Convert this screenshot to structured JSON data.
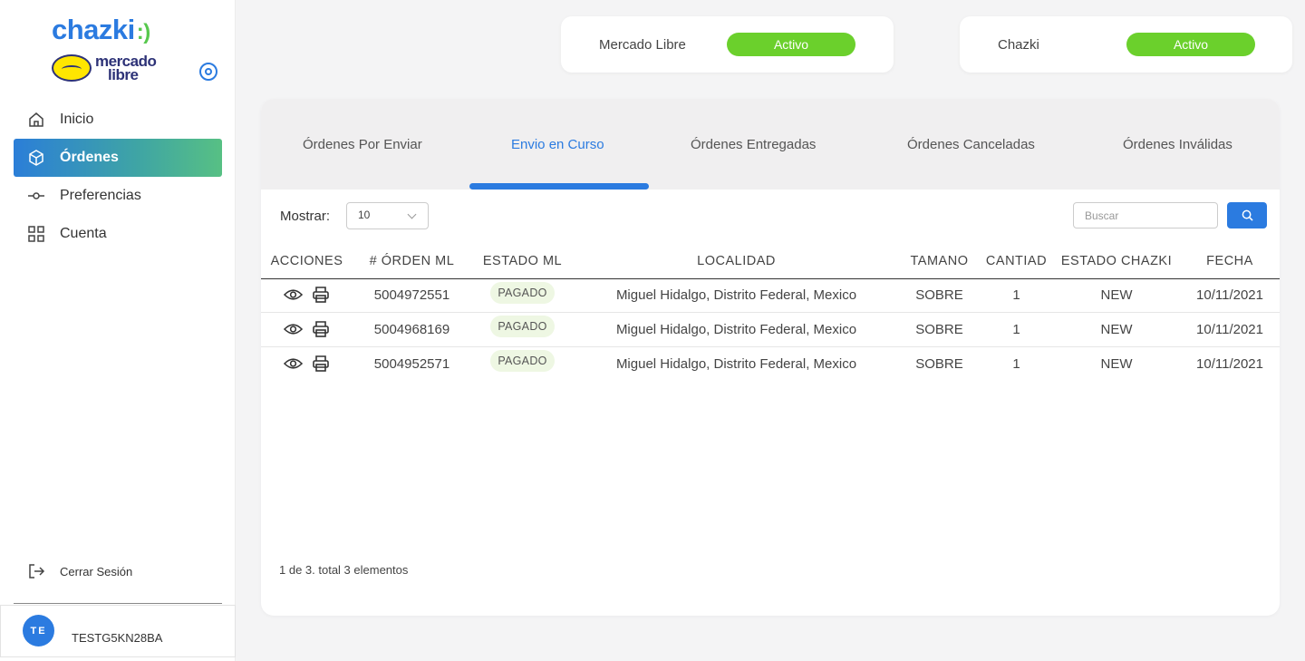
{
  "brand": {
    "chazki": "chazki",
    "ml_line1": "mercado",
    "ml_line2": "libre"
  },
  "sidebar": {
    "items": [
      {
        "label": "Inicio",
        "icon": "home-icon",
        "active": false
      },
      {
        "label": "Órdenes",
        "icon": "box-icon",
        "active": true
      },
      {
        "label": "Preferencias",
        "icon": "commit-icon",
        "active": false
      },
      {
        "label": "Cuenta",
        "icon": "grid-icon",
        "active": false
      }
    ],
    "logout": "Cerrar Sesión",
    "user": {
      "initials": "TE",
      "name": "TESTG5KN28BA"
    }
  },
  "status": [
    {
      "label": "Mercado Libre",
      "state": "Activo"
    },
    {
      "label": "Chazki",
      "state": "Activo"
    }
  ],
  "tabs": [
    {
      "label": "Órdenes Por Enviar"
    },
    {
      "label": "Envio en Curso",
      "active": true
    },
    {
      "label": "Órdenes Entregadas"
    },
    {
      "label": "Órdenes Canceladas"
    },
    {
      "label": "Órdenes Inválidas"
    }
  ],
  "controls": {
    "mostrar_label": "Mostrar:",
    "page_size": "10",
    "search_placeholder": "Buscar"
  },
  "table": {
    "columns": [
      "ACCIONES",
      "# ÓRDEN ML",
      "ESTADO ML",
      "LOCALIDAD",
      "TAMANO",
      "CANTIAD",
      "ESTADO CHAZKI",
      "FECHA"
    ],
    "rows": [
      {
        "order": "5004972551",
        "estado_ml": "PAGADO",
        "localidad": "Miguel Hidalgo, Distrito Federal, Mexico",
        "tamano": "SOBRE",
        "cantidad": "1",
        "estado_chazki": "NEW",
        "fecha": "10/11/2021"
      },
      {
        "order": "5004968169",
        "estado_ml": "PAGADO",
        "localidad": "Miguel Hidalgo, Distrito Federal, Mexico",
        "tamano": "SOBRE",
        "cantidad": "1",
        "estado_chazki": "NEW",
        "fecha": "10/11/2021"
      },
      {
        "order": "5004952571",
        "estado_ml": "PAGADO",
        "localidad": "Miguel Hidalgo, Distrito Federal, Mexico",
        "tamano": "SOBRE",
        "cantidad": "1",
        "estado_chazki": "NEW",
        "fecha": "10/11/2021"
      }
    ]
  },
  "pagination": "1 de 3. total 3 elementos",
  "colors": {
    "primary": "#2b7be0",
    "status_green": "#6bd02c",
    "badge_bg": "#eef7e3"
  }
}
